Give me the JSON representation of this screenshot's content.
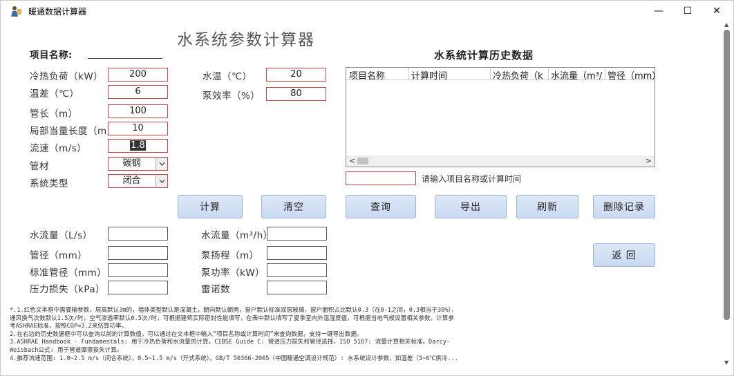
{
  "window": {
    "title": "暖通数据计算器",
    "controls": {
      "minimize": "—",
      "maximize": "☐",
      "close": "✕"
    }
  },
  "header": {
    "page_title": "水系统参数计算器",
    "project_label": "项目名称:"
  },
  "inputs": {
    "load": {
      "label": "冷热负荷（kW）",
      "value": "200"
    },
    "temp_diff": {
      "label": "温差（℃）",
      "value": "6"
    },
    "pipe_length": {
      "label": "管长（m）",
      "value": "100"
    },
    "local_equiv": {
      "label": "局部当量长度（m）",
      "value": "10"
    },
    "velocity": {
      "label": "流速（m/s）",
      "value": "1.8"
    },
    "material": {
      "label": "管材",
      "value": "碳钢"
    },
    "system_type": {
      "label": "系统类型",
      "value": "闭合"
    },
    "water_temp": {
      "label": "水温（℃）",
      "value": "20"
    },
    "pump_eff": {
      "label": "泵效率（%）",
      "value": "80"
    }
  },
  "buttons": {
    "calc": "计算",
    "clear": "清空",
    "query": "查询",
    "export": "导出",
    "refresh": "刷新",
    "delete": "删除记录",
    "back": "返 回"
  },
  "outputs": {
    "flow_ls": "水流量（L/s）",
    "flow_m3h": "水流量（m³/h）",
    "diameter": "管径（mm）",
    "pump_head": "泵扬程（m）",
    "std_diameter": "标准管径（mm）",
    "pump_power": "泵功率（kW）",
    "pressure_loss": "压力损失（kPa）",
    "reynolds": "雷诺数"
  },
  "history": {
    "title": "水系统计算历史数据",
    "columns": [
      "项目名称",
      "计算时间",
      "冷热负荷（k",
      "水流量（m³/",
      "管径（mm）"
    ],
    "search_hint": "请输入项目名称或计算时间"
  },
  "notes": [
    "*.1.红色文本框中需要输参数，层高默认3m的，墙体类型默认是混凝土，朝向默认朝南，窗户默认标准双层玻璃，窗户面积占比默认0.3（在0-1之间，0.3相当于30%），",
    "通风换气次数默认1.5次/时，空气渗透率默认0.5次/时，可根据建筑实际密封性能填写，在表中默认填写了夏季室内外温湿度值，可根据当地气候设置相关参数，计算参",
    "考ASHRAE标准，按照COP=3.2来估算功率。",
    "2.在右边的历史数据框中可以查询以前的计算数值，可以通过在文本框中输入“项目名称或计算时间”来查询数据，支持一键导出数据。",
    "3.ASHRAE Handbook - Fundamentals: 用于冷热负荷和水流量的计算。CIBSE Guide C: 管道压力损失和管径选择。ISO 5167: 流量计算相关标准。Darcy-",
    "Weisbach公式: 用于管道摩擦损失计算。",
    "4.推荐流速范围: 1.0~2.5 m/s（闭合系统），0.5~1.5 m/s（开式系统）。GB/T 50366-2005（中国暖通空调设计规范）: 水系统设计参数，如温差（5~6℃供冷..."
  ]
}
